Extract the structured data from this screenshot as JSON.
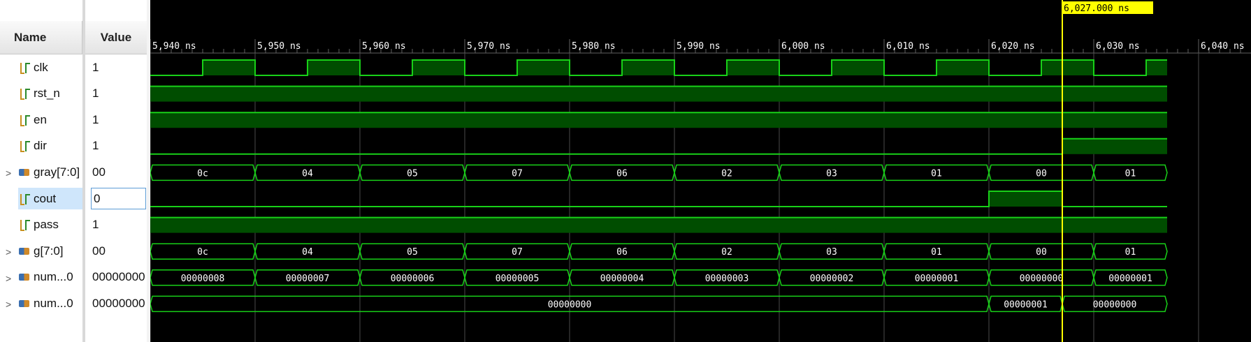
{
  "headers": {
    "name": "Name",
    "value": "Value"
  },
  "cursor": {
    "label": "6,027.000 ns",
    "time": 6027
  },
  "timeline": {
    "start": 5940,
    "end": 6044,
    "ticks": [
      {
        "t": 5940,
        "label": "5,940 ns"
      },
      {
        "t": 5950,
        "label": "5,950 ns"
      },
      {
        "t": 5960,
        "label": "5,960 ns"
      },
      {
        "t": 5970,
        "label": "5,970 ns"
      },
      {
        "t": 5980,
        "label": "5,980 ns"
      },
      {
        "t": 5990,
        "label": "5,990 ns"
      },
      {
        "t": 6000,
        "label": "6,000 ns"
      },
      {
        "t": 6010,
        "label": "6,010 ns"
      },
      {
        "t": 6020,
        "label": "6,020 ns"
      },
      {
        "t": 6030,
        "label": "6,030 ns"
      },
      {
        "t": 6040,
        "label": "6,040 ns"
      }
    ]
  },
  "signals": [
    {
      "name": "clk",
      "value": "1",
      "kind": "bit",
      "expand": false,
      "wave": [
        [
          5940,
          0
        ],
        [
          5945,
          1
        ],
        [
          5950,
          0
        ],
        [
          5955,
          1
        ],
        [
          5960,
          0
        ],
        [
          5965,
          1
        ],
        [
          5970,
          0
        ],
        [
          5975,
          1
        ],
        [
          5980,
          0
        ],
        [
          5985,
          1
        ],
        [
          5990,
          0
        ],
        [
          5995,
          1
        ],
        [
          6000,
          0
        ],
        [
          6005,
          1
        ],
        [
          6010,
          0
        ],
        [
          6015,
          1
        ],
        [
          6020,
          0
        ],
        [
          6025,
          1
        ],
        [
          6030,
          0
        ],
        [
          6035,
          1
        ]
      ]
    },
    {
      "name": "rst_n",
      "value": "1",
      "kind": "bit",
      "expand": false,
      "wave": [
        [
          5940,
          1
        ]
      ]
    },
    {
      "name": "en",
      "value": "1",
      "kind": "bit",
      "expand": false,
      "wave": [
        [
          5940,
          1
        ]
      ]
    },
    {
      "name": "dir",
      "value": "1",
      "kind": "bit",
      "expand": false,
      "wave": [
        [
          5940,
          0
        ],
        [
          6027,
          1
        ]
      ]
    },
    {
      "name": "gray[7:0]",
      "value": "00",
      "kind": "bus",
      "expand": true,
      "wave": [
        [
          5940,
          "0c"
        ],
        [
          5950,
          "04"
        ],
        [
          5960,
          "05"
        ],
        [
          5970,
          "07"
        ],
        [
          5980,
          "06"
        ],
        [
          5990,
          "02"
        ],
        [
          6000,
          "03"
        ],
        [
          6010,
          "01"
        ],
        [
          6020,
          "00"
        ],
        [
          6030,
          "01"
        ]
      ]
    },
    {
      "name": "cout",
      "value": "0",
      "kind": "bit",
      "expand": false,
      "selected": true,
      "wave": [
        [
          5940,
          0
        ],
        [
          6020,
          1
        ],
        [
          6027,
          0
        ]
      ]
    },
    {
      "name": "pass",
      "value": "1",
      "kind": "bit",
      "expand": false,
      "wave": [
        [
          5940,
          1
        ]
      ]
    },
    {
      "name": "g[7:0]",
      "value": "00",
      "kind": "bus",
      "expand": true,
      "wave": [
        [
          5940,
          "0c"
        ],
        [
          5950,
          "04"
        ],
        [
          5960,
          "05"
        ],
        [
          5970,
          "07"
        ],
        [
          5980,
          "06"
        ],
        [
          5990,
          "02"
        ],
        [
          6000,
          "03"
        ],
        [
          6010,
          "01"
        ],
        [
          6020,
          "00"
        ],
        [
          6030,
          "01"
        ]
      ]
    },
    {
      "name": "num...0",
      "value": "00000000",
      "kind": "bus",
      "expand": true,
      "wave": [
        [
          5940,
          "00000008"
        ],
        [
          5950,
          "00000007"
        ],
        [
          5960,
          "00000006"
        ],
        [
          5970,
          "00000005"
        ],
        [
          5980,
          "00000004"
        ],
        [
          5990,
          "00000003"
        ],
        [
          6000,
          "00000002"
        ],
        [
          6010,
          "00000001"
        ],
        [
          6020,
          "00000000"
        ],
        [
          6030,
          "00000001"
        ]
      ]
    },
    {
      "name": "num...0",
      "value": "00000000",
      "kind": "bus",
      "expand": true,
      "wave": [
        [
          5940,
          "00000000"
        ],
        [
          6020,
          "00000001"
        ],
        [
          6027,
          "00000000"
        ]
      ]
    }
  ],
  "colors": {
    "wave": "#18d018",
    "fill": "#004d00",
    "grid": "#606060",
    "cursor": "#ffff00",
    "text": "#ffffff"
  }
}
